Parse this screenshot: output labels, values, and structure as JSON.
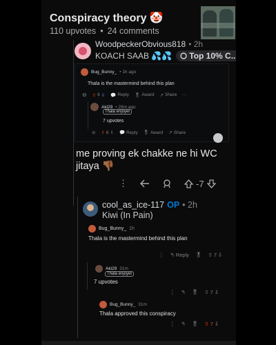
{
  "post": {
    "title": "Conspiracy theory 🤡",
    "upvotes": "110 upvotes",
    "comments": "24 comments"
  },
  "comment1": {
    "username": "WoodpeckerObvious818",
    "time": "• 2h",
    "flair": "KOACH SAAB 💦💦",
    "badge": "Top 10% C...",
    "body": "me proving ek chakke ne hi WC jitaya 👎🏾",
    "votes": "-7"
  },
  "screenshot1": {
    "user1": "Bug_Bunny_",
    "time1": "• 1h ago",
    "text1": "Thala is the mastermind behind this plan",
    "votes1": "6",
    "reply": "Reply",
    "award": "Award",
    "share": "Share",
    "more": "···",
    "user2": "Aki29",
    "time2": "• 29m ago",
    "flair2": "Thala enjoyer",
    "text2": "7 upvotes",
    "votes2": "6"
  },
  "comment2": {
    "username": "cool_as_ice-117",
    "op": "OP",
    "time": "• 2h",
    "flair": "Kiwi (In Pain)"
  },
  "nested": {
    "user1": "Bug_Bunny_",
    "time1": "1h",
    "text1": "Thala is the mastermind behind this plan",
    "reply": "Reply",
    "votes1": "7",
    "user2": "Aki29",
    "time2": "31m",
    "flair2": "Thala enjoyer",
    "text2": "7 upvotes",
    "votes2": "7",
    "user3": "Bug_Bunny_",
    "time3": "31m",
    "text3": "Thala approved this conspiracy",
    "votes3": "7"
  }
}
